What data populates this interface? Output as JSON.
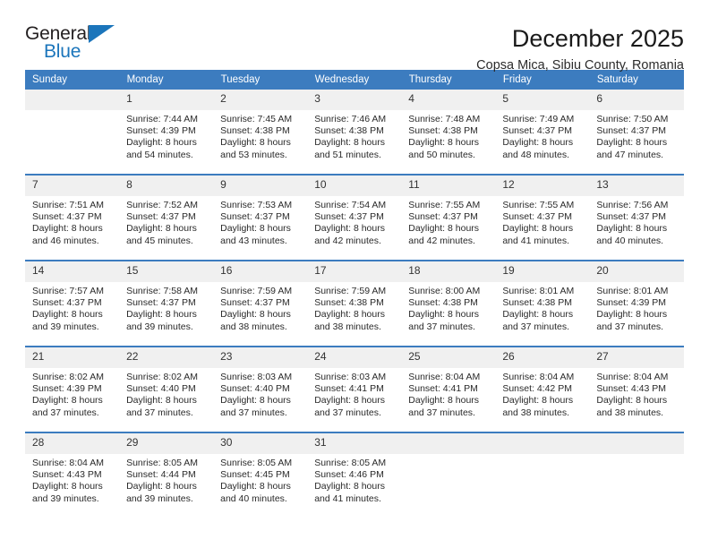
{
  "brand": {
    "name_top": "General",
    "name_bottom": "Blue",
    "triangle_icon": "blue-triangle-icon",
    "color_dark": "#231f20",
    "color_blue": "#1b75bb"
  },
  "header": {
    "title": "December 2025",
    "subtitle": "Copsa Mica, Sibiu County, Romania"
  },
  "theme": {
    "header_bg": "#3c7cbf",
    "header_text": "#ffffff",
    "daynum_bg": "#f0f0f0",
    "cell_bg": "#ffffff",
    "rule": "#3c7cbf"
  },
  "calendar": {
    "weekday_headers": [
      "Sunday",
      "Monday",
      "Tuesday",
      "Wednesday",
      "Thursday",
      "Friday",
      "Saturday"
    ],
    "weeks": [
      {
        "days": [
          {
            "num": "",
            "lines": []
          },
          {
            "num": "1",
            "lines": [
              "Sunrise: 7:44 AM",
              "Sunset: 4:39 PM",
              "Daylight: 8 hours",
              "and 54 minutes."
            ]
          },
          {
            "num": "2",
            "lines": [
              "Sunrise: 7:45 AM",
              "Sunset: 4:38 PM",
              "Daylight: 8 hours",
              "and 53 minutes."
            ]
          },
          {
            "num": "3",
            "lines": [
              "Sunrise: 7:46 AM",
              "Sunset: 4:38 PM",
              "Daylight: 8 hours",
              "and 51 minutes."
            ]
          },
          {
            "num": "4",
            "lines": [
              "Sunrise: 7:48 AM",
              "Sunset: 4:38 PM",
              "Daylight: 8 hours",
              "and 50 minutes."
            ]
          },
          {
            "num": "5",
            "lines": [
              "Sunrise: 7:49 AM",
              "Sunset: 4:37 PM",
              "Daylight: 8 hours",
              "and 48 minutes."
            ]
          },
          {
            "num": "6",
            "lines": [
              "Sunrise: 7:50 AM",
              "Sunset: 4:37 PM",
              "Daylight: 8 hours",
              "and 47 minutes."
            ]
          }
        ]
      },
      {
        "days": [
          {
            "num": "7",
            "lines": [
              "Sunrise: 7:51 AM",
              "Sunset: 4:37 PM",
              "Daylight: 8 hours",
              "and 46 minutes."
            ]
          },
          {
            "num": "8",
            "lines": [
              "Sunrise: 7:52 AM",
              "Sunset: 4:37 PM",
              "Daylight: 8 hours",
              "and 45 minutes."
            ]
          },
          {
            "num": "9",
            "lines": [
              "Sunrise: 7:53 AM",
              "Sunset: 4:37 PM",
              "Daylight: 8 hours",
              "and 43 minutes."
            ]
          },
          {
            "num": "10",
            "lines": [
              "Sunrise: 7:54 AM",
              "Sunset: 4:37 PM",
              "Daylight: 8 hours",
              "and 42 minutes."
            ]
          },
          {
            "num": "11",
            "lines": [
              "Sunrise: 7:55 AM",
              "Sunset: 4:37 PM",
              "Daylight: 8 hours",
              "and 42 minutes."
            ]
          },
          {
            "num": "12",
            "lines": [
              "Sunrise: 7:55 AM",
              "Sunset: 4:37 PM",
              "Daylight: 8 hours",
              "and 41 minutes."
            ]
          },
          {
            "num": "13",
            "lines": [
              "Sunrise: 7:56 AM",
              "Sunset: 4:37 PM",
              "Daylight: 8 hours",
              "and 40 minutes."
            ]
          }
        ]
      },
      {
        "days": [
          {
            "num": "14",
            "lines": [
              "Sunrise: 7:57 AM",
              "Sunset: 4:37 PM",
              "Daylight: 8 hours",
              "and 39 minutes."
            ]
          },
          {
            "num": "15",
            "lines": [
              "Sunrise: 7:58 AM",
              "Sunset: 4:37 PM",
              "Daylight: 8 hours",
              "and 39 minutes."
            ]
          },
          {
            "num": "16",
            "lines": [
              "Sunrise: 7:59 AM",
              "Sunset: 4:37 PM",
              "Daylight: 8 hours",
              "and 38 minutes."
            ]
          },
          {
            "num": "17",
            "lines": [
              "Sunrise: 7:59 AM",
              "Sunset: 4:38 PM",
              "Daylight: 8 hours",
              "and 38 minutes."
            ]
          },
          {
            "num": "18",
            "lines": [
              "Sunrise: 8:00 AM",
              "Sunset: 4:38 PM",
              "Daylight: 8 hours",
              "and 37 minutes."
            ]
          },
          {
            "num": "19",
            "lines": [
              "Sunrise: 8:01 AM",
              "Sunset: 4:38 PM",
              "Daylight: 8 hours",
              "and 37 minutes."
            ]
          },
          {
            "num": "20",
            "lines": [
              "Sunrise: 8:01 AM",
              "Sunset: 4:39 PM",
              "Daylight: 8 hours",
              "and 37 minutes."
            ]
          }
        ]
      },
      {
        "days": [
          {
            "num": "21",
            "lines": [
              "Sunrise: 8:02 AM",
              "Sunset: 4:39 PM",
              "Daylight: 8 hours",
              "and 37 minutes."
            ]
          },
          {
            "num": "22",
            "lines": [
              "Sunrise: 8:02 AM",
              "Sunset: 4:40 PM",
              "Daylight: 8 hours",
              "and 37 minutes."
            ]
          },
          {
            "num": "23",
            "lines": [
              "Sunrise: 8:03 AM",
              "Sunset: 4:40 PM",
              "Daylight: 8 hours",
              "and 37 minutes."
            ]
          },
          {
            "num": "24",
            "lines": [
              "Sunrise: 8:03 AM",
              "Sunset: 4:41 PM",
              "Daylight: 8 hours",
              "and 37 minutes."
            ]
          },
          {
            "num": "25",
            "lines": [
              "Sunrise: 8:04 AM",
              "Sunset: 4:41 PM",
              "Daylight: 8 hours",
              "and 37 minutes."
            ]
          },
          {
            "num": "26",
            "lines": [
              "Sunrise: 8:04 AM",
              "Sunset: 4:42 PM",
              "Daylight: 8 hours",
              "and 38 minutes."
            ]
          },
          {
            "num": "27",
            "lines": [
              "Sunrise: 8:04 AM",
              "Sunset: 4:43 PM",
              "Daylight: 8 hours",
              "and 38 minutes."
            ]
          }
        ]
      },
      {
        "days": [
          {
            "num": "28",
            "lines": [
              "Sunrise: 8:04 AM",
              "Sunset: 4:43 PM",
              "Daylight: 8 hours",
              "and 39 minutes."
            ]
          },
          {
            "num": "29",
            "lines": [
              "Sunrise: 8:05 AM",
              "Sunset: 4:44 PM",
              "Daylight: 8 hours",
              "and 39 minutes."
            ]
          },
          {
            "num": "30",
            "lines": [
              "Sunrise: 8:05 AM",
              "Sunset: 4:45 PM",
              "Daylight: 8 hours",
              "and 40 minutes."
            ]
          },
          {
            "num": "31",
            "lines": [
              "Sunrise: 8:05 AM",
              "Sunset: 4:46 PM",
              "Daylight: 8 hours",
              "and 41 minutes."
            ]
          },
          {
            "num": "",
            "lines": []
          },
          {
            "num": "",
            "lines": []
          },
          {
            "num": "",
            "lines": []
          }
        ]
      }
    ]
  }
}
